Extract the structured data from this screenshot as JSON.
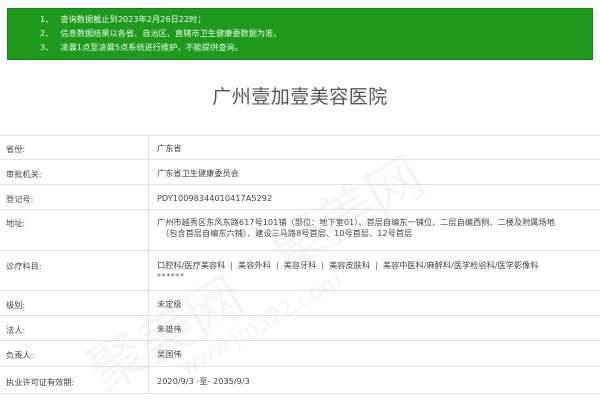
{
  "notice": {
    "items": [
      {
        "num": "1、",
        "text": "查询数据截止到2023年2月26日22时；"
      },
      {
        "num": "2、",
        "text": "信息数据结果以各省、自治区、直辖市卫生健康委数据为准。"
      },
      {
        "num": "3、",
        "text": "凌晨1点至凌晨5点系统进行维护，不能提供查询。"
      }
    ]
  },
  "title": "广州壹加壹美容医院",
  "rows": {
    "province": {
      "label": "省份:",
      "value": "广东省"
    },
    "authority": {
      "label": "审批机关:",
      "value": "广东省卫生健康委员会"
    },
    "registration": {
      "label": "登记号:",
      "value": "PDY10098344010417A5292"
    },
    "address": {
      "label": "地址:",
      "line1": "广州市越秀区东风东路617号101铺（部位：地下室01）、首层自编东一铺位、二层自编西侧、二楼及附属场地",
      "line2": "（包含首层自编东六铺）、建设三马路8号首层、10号首层、12号首层"
    },
    "departments": {
      "label": "诊疗科目:",
      "items": [
        "口腔科",
        "/医疗美容科",
        "美容外科",
        "美容牙科",
        "美容皮肤科",
        "美容中医科",
        "/麻醉科",
        "/医学检验科",
        "/医学影像科"
      ],
      "separators": [
        "",
        "|",
        "|",
        "|",
        "|",
        "",
        "",
        ""
      ],
      "extra": "******"
    },
    "level": {
      "label": "级别:",
      "value": "未定级"
    },
    "legal_person": {
      "label": "法人:",
      "value": "朱雄伟"
    },
    "principal": {
      "label": "负责人:",
      "value": "吴国伟"
    },
    "validity": {
      "label": "执业许可证有效期:",
      "value": "2020/9/3 -至- 2035/9/3"
    }
  },
  "watermark": {
    "text": "聚美网",
    "url": "www.jm322.com"
  },
  "colors": {
    "notice_bg": "#1f9a1f",
    "notice_text": "#eaffea",
    "border": "#e3e3e3"
  }
}
